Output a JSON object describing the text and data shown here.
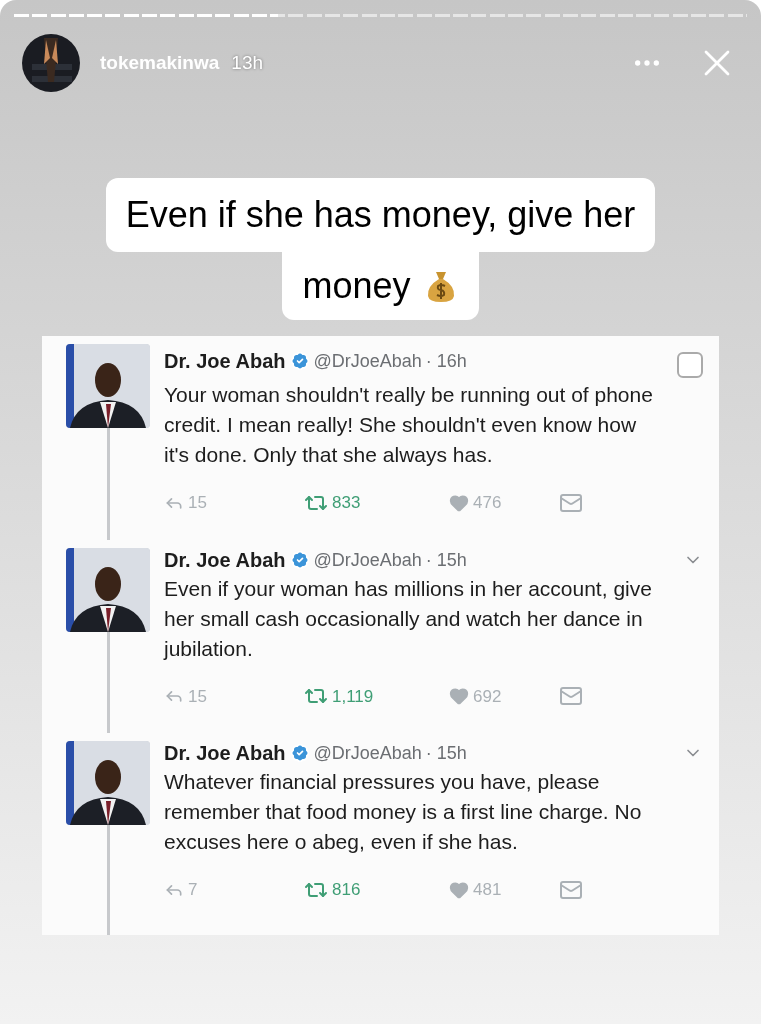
{
  "story": {
    "progress": {
      "level": 0.36
    },
    "username": "tokemakinwa",
    "time": "13h"
  },
  "caption": {
    "lines": [
      "Even if she has money, give her",
      "money"
    ]
  },
  "tweets": [
    {
      "name": "Dr. Joe Abah",
      "handle": "@DrJoeAbah",
      "time": "· 16h",
      "kind": "covered",
      "text": "Your woman shouldn't really be running out of phone credit. I mean really! She shouldn't even know how it's done. Only that she always has.",
      "replies": "15",
      "retweets": "833",
      "likes": "476"
    },
    {
      "name": "Dr. Joe Abah",
      "handle": "@DrJoeAbah",
      "time": "· 15h",
      "kind": "plain",
      "text": "Even if your woman has millions in her account, give her small cash occasionally and watch her dance in jubilation.",
      "replies": "15",
      "retweets": "1,119",
      "likes": "692"
    },
    {
      "name": "Dr. Joe Abah",
      "handle": "@DrJoeAbah",
      "time": "· 15h",
      "kind": "plain",
      "text": "Whatever financial pressures you have, please remember that food money is a first line charge. No excuses here o abeg, even if she has.",
      "replies": "7",
      "retweets": "816",
      "likes": "481"
    }
  ]
}
